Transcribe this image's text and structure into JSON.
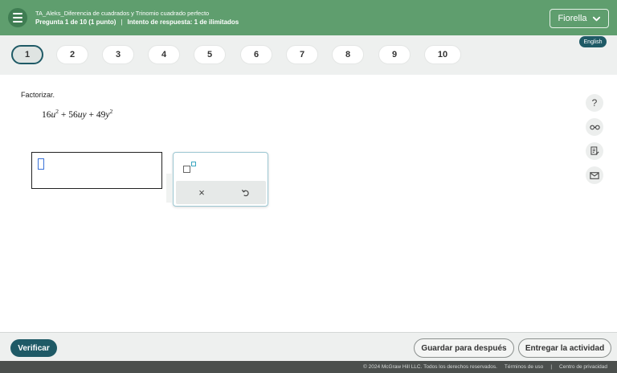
{
  "header": {
    "assignment_title": "TA_Aleks_Diferencia de cuadrados y Trinomio cuadrado perfecto",
    "question_info": "Pregunta 1 de 10 (1 punto)",
    "separator": "|",
    "attempt_info": "Intento de respuesta: 1 de ilimitados",
    "user_name": "Fiorella"
  },
  "question_nav": {
    "items": [
      "1",
      "2",
      "3",
      "4",
      "5",
      "6",
      "7",
      "8",
      "9",
      "10"
    ],
    "active_index": 0
  },
  "language_badge": "English",
  "question": {
    "prompt": "Factorizar.",
    "expression": {
      "t1_coef": "16",
      "t1_var": "u",
      "t1_exp": "2",
      "op1": " + ",
      "t2_coef": "56",
      "t2_var": "uy",
      "op2": " + ",
      "t3_coef": "49",
      "t3_var": "y",
      "t3_exp": "2"
    }
  },
  "palette": {
    "x_symbol": "×"
  },
  "side_tools": {
    "help": "?"
  },
  "footer": {
    "verify": "Verificar",
    "save": "Guardar para después",
    "submit": "Entregar la actividad"
  },
  "legal": {
    "copyright": "© 2024 McGraw Hill LLC. Todos los derechos reservados.",
    "terms": "Términos de uso",
    "separator": "|",
    "privacy": "Centro de privacidad"
  },
  "colors": {
    "header_green": "#5f9e6e",
    "accent_teal": "#1f5a66",
    "nav_gray": "#eef0ef"
  }
}
